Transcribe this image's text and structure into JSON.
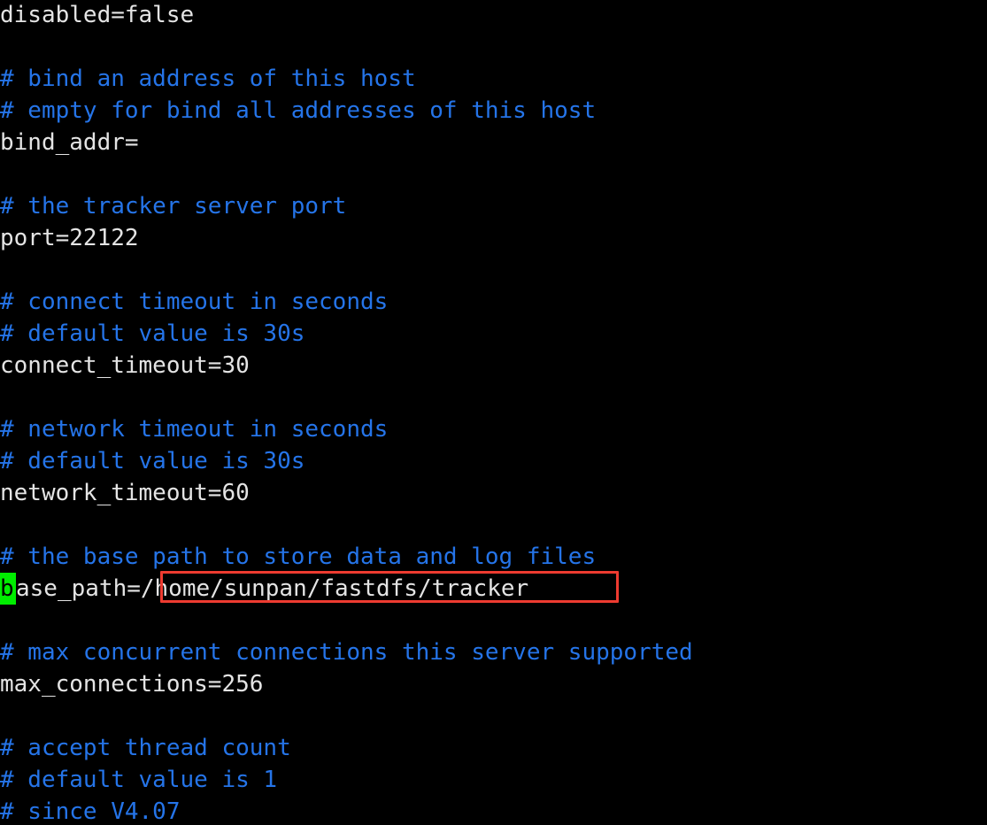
{
  "window": {
    "kind": "terminal-text-editor",
    "file_type": "fastdfs-tracker-conf",
    "background_color": "#000000",
    "comment_color": "#2574E8",
    "text_color": "#E4E4E4",
    "cursor_color": "#00EE00",
    "annotation_color": "#EE3B30"
  },
  "cursor": {
    "character": "b",
    "on_line_index": 19,
    "column": 1,
    "style": "block"
  },
  "annotation": {
    "shape": "rectangle",
    "color": "#EE3B30",
    "highlighted_text": "/home/sunpan/fastdfs/tracker",
    "on_line_index": 19
  },
  "config": {
    "disabled": "false",
    "bind_addr": "",
    "port": "22122",
    "connect_timeout": "30",
    "network_timeout": "60",
    "base_path": "/home/sunpan/fastdfs/tracker",
    "max_connections": "256"
  },
  "lines": [
    {
      "type": "plain",
      "text": "disabled=false"
    },
    {
      "type": "blank",
      "text": ""
    },
    {
      "type": "comment",
      "text": "# bind an address of this host"
    },
    {
      "type": "comment",
      "text": "# empty for bind all addresses of this host"
    },
    {
      "type": "plain",
      "text": "bind_addr="
    },
    {
      "type": "blank",
      "text": ""
    },
    {
      "type": "comment",
      "text": "# the tracker server port"
    },
    {
      "type": "plain",
      "text": "port=22122"
    },
    {
      "type": "blank",
      "text": ""
    },
    {
      "type": "comment",
      "text": "# connect timeout in seconds"
    },
    {
      "type": "comment",
      "text": "# default value is 30s"
    },
    {
      "type": "plain",
      "text": "connect_timeout=30"
    },
    {
      "type": "blank",
      "text": ""
    },
    {
      "type": "comment",
      "text": "# network timeout in seconds"
    },
    {
      "type": "comment",
      "text": "# default value is 30s"
    },
    {
      "type": "plain",
      "text": "network_timeout=60"
    },
    {
      "type": "blank",
      "text": ""
    },
    {
      "type": "comment",
      "text": "# the base path to store data and log files"
    },
    {
      "type": "cursor-plain",
      "cursor_char": "b",
      "text": "ase_path=/home/sunpan/fastdfs/tracker"
    },
    {
      "type": "blank",
      "text": ""
    },
    {
      "type": "comment",
      "text": "# max concurrent connections this server supported"
    },
    {
      "type": "plain",
      "text": "max_connections=256"
    },
    {
      "type": "blank",
      "text": ""
    },
    {
      "type": "comment",
      "text": "# accept thread count"
    },
    {
      "type": "comment",
      "text": "# default value is 1"
    },
    {
      "type": "comment",
      "text": "# since V4.07"
    }
  ]
}
